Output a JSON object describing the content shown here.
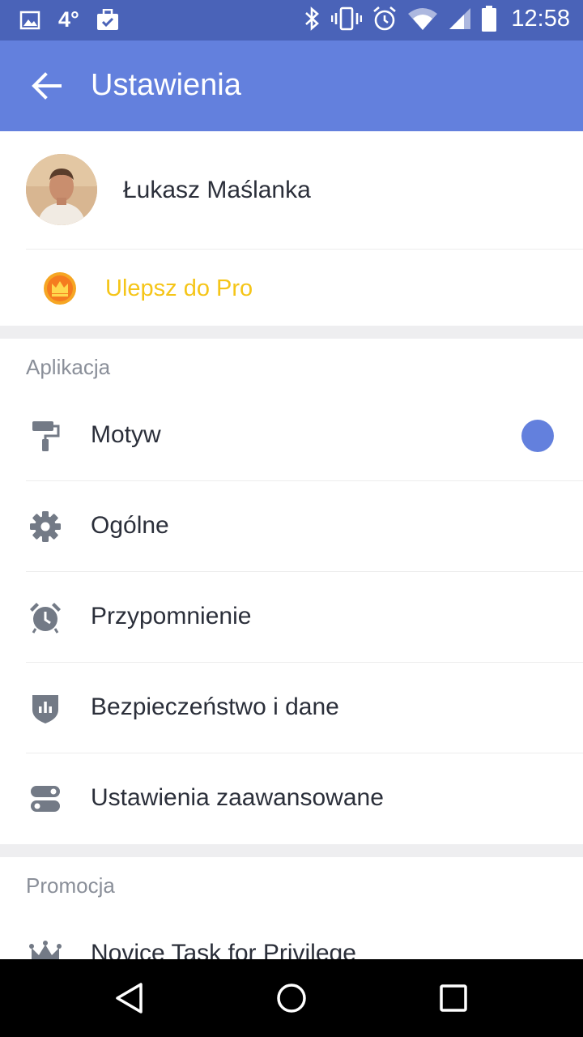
{
  "status_bar": {
    "temperature": "4°",
    "time": "12:58",
    "icons": [
      "image-icon",
      "briefcase-check-icon",
      "bluetooth-icon",
      "vibrate-icon",
      "alarm-icon",
      "wifi-icon",
      "signal-icon",
      "battery-icon"
    ]
  },
  "app_bar": {
    "title": "Ustawienia",
    "back_icon": "arrow-back-icon"
  },
  "profile": {
    "name": "Łukasz Maślanka"
  },
  "upgrade": {
    "label": "Ulepsz do Pro",
    "color": "#f5c518"
  },
  "sections": {
    "app": {
      "title": "Aplikacja",
      "items": [
        {
          "label": "Motyw",
          "icon": "paint-roller-icon"
        },
        {
          "label": "Ogólne",
          "icon": "gear-icon"
        },
        {
          "label": "Przypomnienie",
          "icon": "alarm-clock-icon"
        },
        {
          "label": "Bezpieczeństwo i dane",
          "icon": "shield-icon"
        },
        {
          "label": "Ustawienia zaawansowane",
          "icon": "toggle-settings-icon"
        }
      ]
    },
    "promo": {
      "title": "Promocja",
      "items": [
        {
          "label": "Novice Task for Privilege",
          "icon": "crown-icon"
        }
      ]
    }
  },
  "colors": {
    "status_bar": "#4a63b8",
    "app_bar": "#6380dd",
    "theme_accent": "#6380dd",
    "icon_gray": "#737a86"
  },
  "nav_bar": [
    "back-triangle-icon",
    "home-circle-icon",
    "recents-square-icon"
  ]
}
